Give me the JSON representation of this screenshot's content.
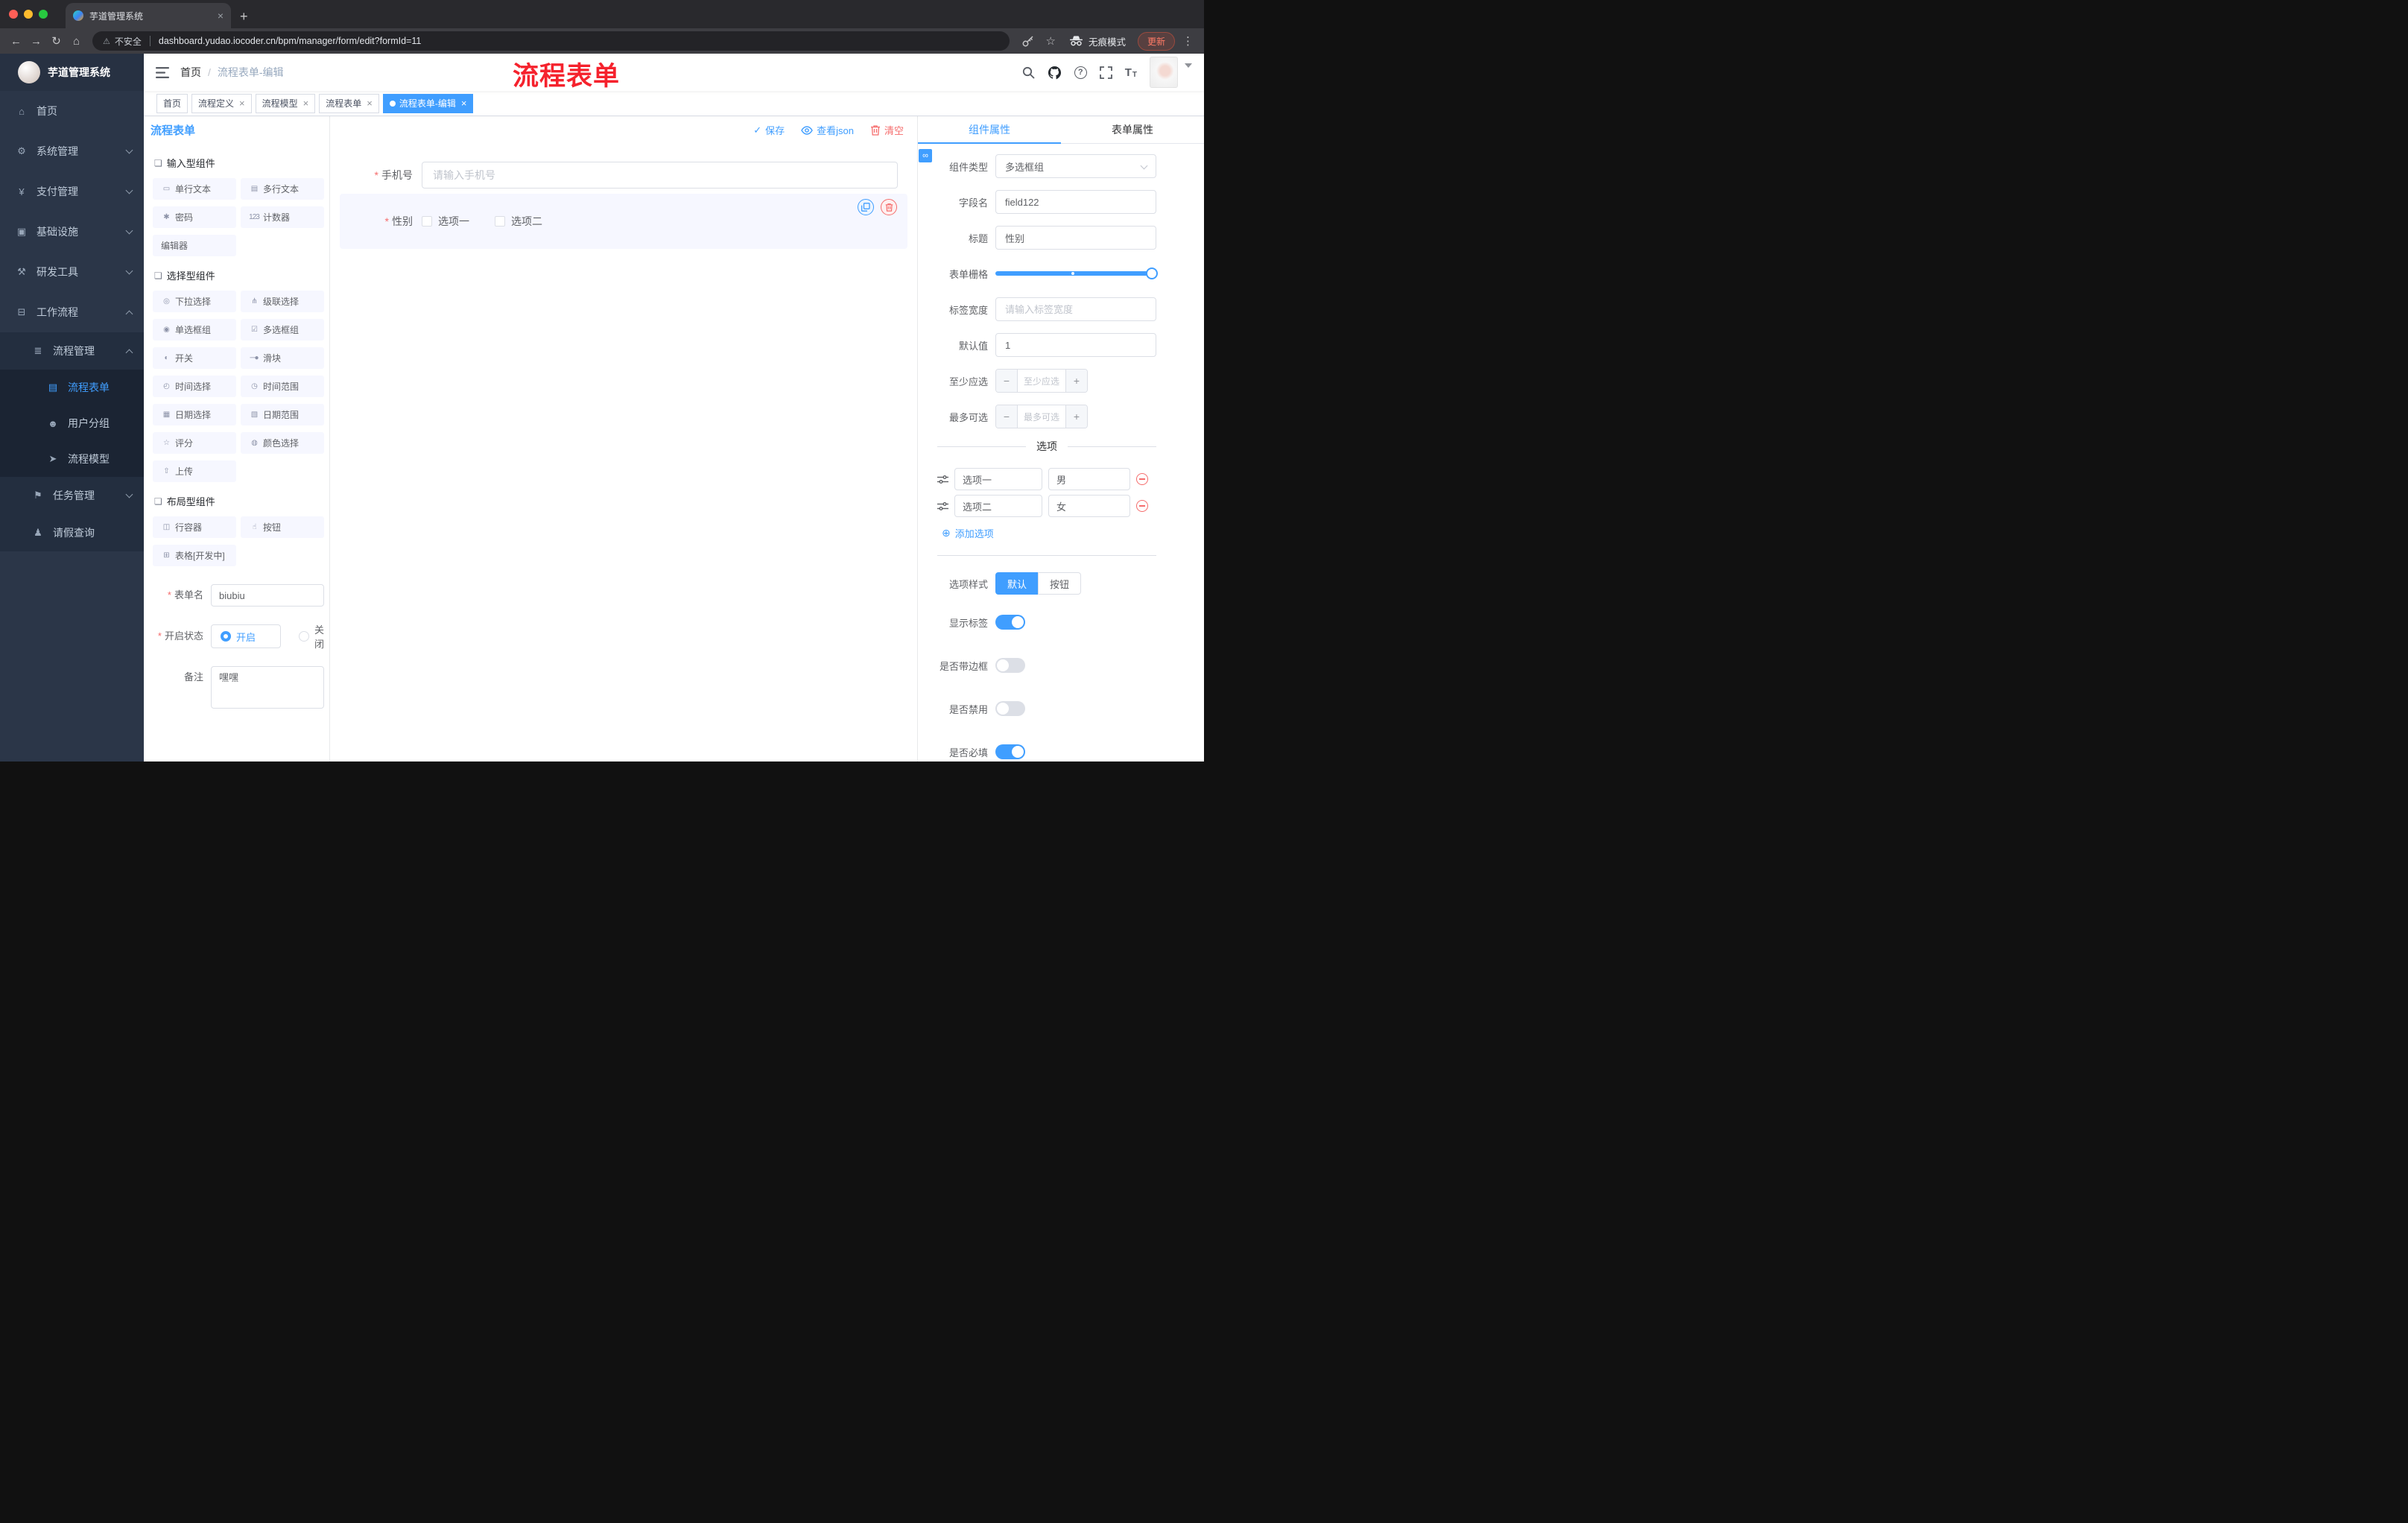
{
  "theme": {
    "accent": "#409EFF",
    "danger": "#F56C6C",
    "sidebar_bg": "#2B3648"
  },
  "icons": {
    "back": "←",
    "forward": "→",
    "reload": "↻",
    "home": "⌂",
    "warning": "⚠",
    "star": "☆",
    "menu_dots": "⋮",
    "new_tab": "+",
    "tab_close": "×",
    "check": "✓",
    "link": "∞",
    "add": "⊕",
    "question": "?"
  },
  "browser": {
    "tab_title": "芋道管理系统",
    "security_label": "不安全",
    "url": "dashboard.yudao.iocoder.cn/bpm/manager/form/edit?formId=11",
    "incognito_label": "无痕模式",
    "update_label": "更新"
  },
  "annotation_text": "流程表单",
  "sidebar": {
    "logo_text": "芋道管理系统",
    "items": [
      {
        "label": "首页",
        "icon": "home-icon",
        "glyph": "⌂"
      },
      {
        "label": "系统管理",
        "icon": "gear-icon",
        "glyph": "⚙"
      },
      {
        "label": "支付管理",
        "icon": "payment-icon",
        "glyph": "¥"
      },
      {
        "label": "基础设施",
        "icon": "infrastructure-icon",
        "glyph": "▣"
      },
      {
        "label": "研发工具",
        "icon": "devtools-icon",
        "glyph": "⚒"
      },
      {
        "label": "工作流程",
        "icon": "workflow-icon",
        "glyph": "⊟"
      },
      {
        "label": "流程管理",
        "icon": "process-management-icon",
        "glyph": "≣"
      },
      {
        "label": "流程表单",
        "icon": "process-form-icon",
        "glyph": "▤",
        "active": true
      },
      {
        "label": "用户分组",
        "icon": "user-group-icon",
        "glyph": "☻"
      },
      {
        "label": "流程模型",
        "icon": "process-model-icon",
        "glyph": "➤"
      },
      {
        "label": "任务管理",
        "icon": "task-management-icon",
        "glyph": "⚑"
      },
      {
        "label": "请假查询",
        "icon": "leave-query-icon",
        "glyph": "♟"
      }
    ]
  },
  "navbar": {
    "breadcrumb": {
      "home": "首页",
      "separator": "/",
      "current": "流程表单-编辑"
    }
  },
  "tags": [
    {
      "label": "首页",
      "closable": false,
      "active": false
    },
    {
      "label": "流程定义",
      "closable": true,
      "active": false
    },
    {
      "label": "流程模型",
      "closable": true,
      "active": false
    },
    {
      "label": "流程表单",
      "closable": true,
      "active": false
    },
    {
      "label": "流程表单-编辑",
      "closable": true,
      "active": true
    }
  ],
  "palette": {
    "title": "流程表单",
    "group_input": {
      "title": "输入型组件",
      "icon": "component-group-icon",
      "icon_glyph": "❏",
      "items": [
        {
          "label": "单行文本",
          "icon": "single-line-text-icon",
          "glyph": "▭"
        },
        {
          "label": "多行文本",
          "icon": "multi-line-text-icon",
          "glyph": "▤"
        },
        {
          "label": "密码",
          "icon": "password-icon",
          "glyph": "✱"
        },
        {
          "label": "计数器",
          "icon": "counter-icon",
          "glyph": "123"
        },
        {
          "label": "编辑器",
          "icon": "editor-icon",
          "glyph": ""
        }
      ]
    },
    "group_select": {
      "title": "选择型组件",
      "icon": "component-group-icon",
      "icon_glyph": "❏",
      "items": [
        {
          "label": "下拉选择",
          "icon": "select-icon",
          "glyph": "◎"
        },
        {
          "label": "级联选择",
          "icon": "cascader-icon",
          "glyph": "⋔"
        },
        {
          "label": "单选框组",
          "icon": "radio-group-icon",
          "glyph": "◉"
        },
        {
          "label": "多选框组",
          "icon": "checkbox-group-icon",
          "glyph": "☑"
        },
        {
          "label": "开关",
          "icon": "switch-icon",
          "glyph": "◐"
        },
        {
          "label": "滑块",
          "icon": "slider-icon",
          "glyph": "─●"
        },
        {
          "label": "时间选择",
          "icon": "time-picker-icon",
          "glyph": "◴"
        },
        {
          "label": "时间范围",
          "icon": "time-range-icon",
          "glyph": "◷"
        },
        {
          "label": "日期选择",
          "icon": "date-picker-icon",
          "glyph": "▦"
        },
        {
          "label": "日期范围",
          "icon": "date-range-icon",
          "glyph": "▧"
        },
        {
          "label": "评分",
          "icon": "rate-icon",
          "glyph": "☆"
        },
        {
          "label": "颜色选择",
          "icon": "color-picker-icon",
          "glyph": "◍"
        },
        {
          "label": "上传",
          "icon": "upload-icon",
          "glyph": "⇧"
        }
      ]
    },
    "group_layout": {
      "title": "布局型组件",
      "icon": "component-group-icon",
      "icon_glyph": "❏",
      "items": [
        {
          "label": "行容器",
          "icon": "row-container-icon",
          "glyph": "◫"
        },
        {
          "label": "按钮",
          "icon": "button-icon",
          "glyph": "☝"
        },
        {
          "label": "表格[开发中]",
          "icon": "table-icon",
          "glyph": "⊞"
        }
      ]
    },
    "form": {
      "name_label": "表单名",
      "name_value": "biubiu",
      "status_label": "开启状态",
      "status_on": "开启",
      "status_off": "关闭",
      "status_selected": "开启",
      "remark_label": "备注",
      "remark_value": "嘿嘿"
    }
  },
  "canvas": {
    "toolbar": {
      "save": "保存",
      "view_json": "查看json",
      "clear": "清空"
    },
    "phone_field": {
      "label": "手机号",
      "placeholder": "请输入手机号"
    },
    "gender_field": {
      "label": "性别",
      "options": [
        "选项一",
        "选项二"
      ]
    }
  },
  "props": {
    "tab_component": "组件属性",
    "tab_form": "表单属性",
    "component_type_label": "组件类型",
    "component_type_value": "多选框组",
    "field_name_label": "字段名",
    "field_name_value": "field122",
    "title_label": "标题",
    "title_value": "性别",
    "grid_label": "表单栅格",
    "label_width_label": "标签宽度",
    "label_width_placeholder": "请输入标签宽度",
    "default_label": "默认值",
    "default_value": "1",
    "min_label": "至少应选",
    "min_placeholder": "至少应选",
    "max_label": "最多可选",
    "max_placeholder": "最多可选",
    "options_title": "选项",
    "options": [
      {
        "name": "选项一",
        "value": "男"
      },
      {
        "name": "选项二",
        "value": "女"
      }
    ],
    "add_option_label": "添加选项",
    "style_label": "选项样式",
    "style_choices": [
      "默认",
      "按钮"
    ],
    "style_selected": "默认",
    "switches": [
      {
        "label": "显示标签",
        "on": true
      },
      {
        "label": "是否带边框",
        "on": false
      },
      {
        "label": "是否禁用",
        "on": false
      },
      {
        "label": "是否必填",
        "on": true
      }
    ]
  }
}
